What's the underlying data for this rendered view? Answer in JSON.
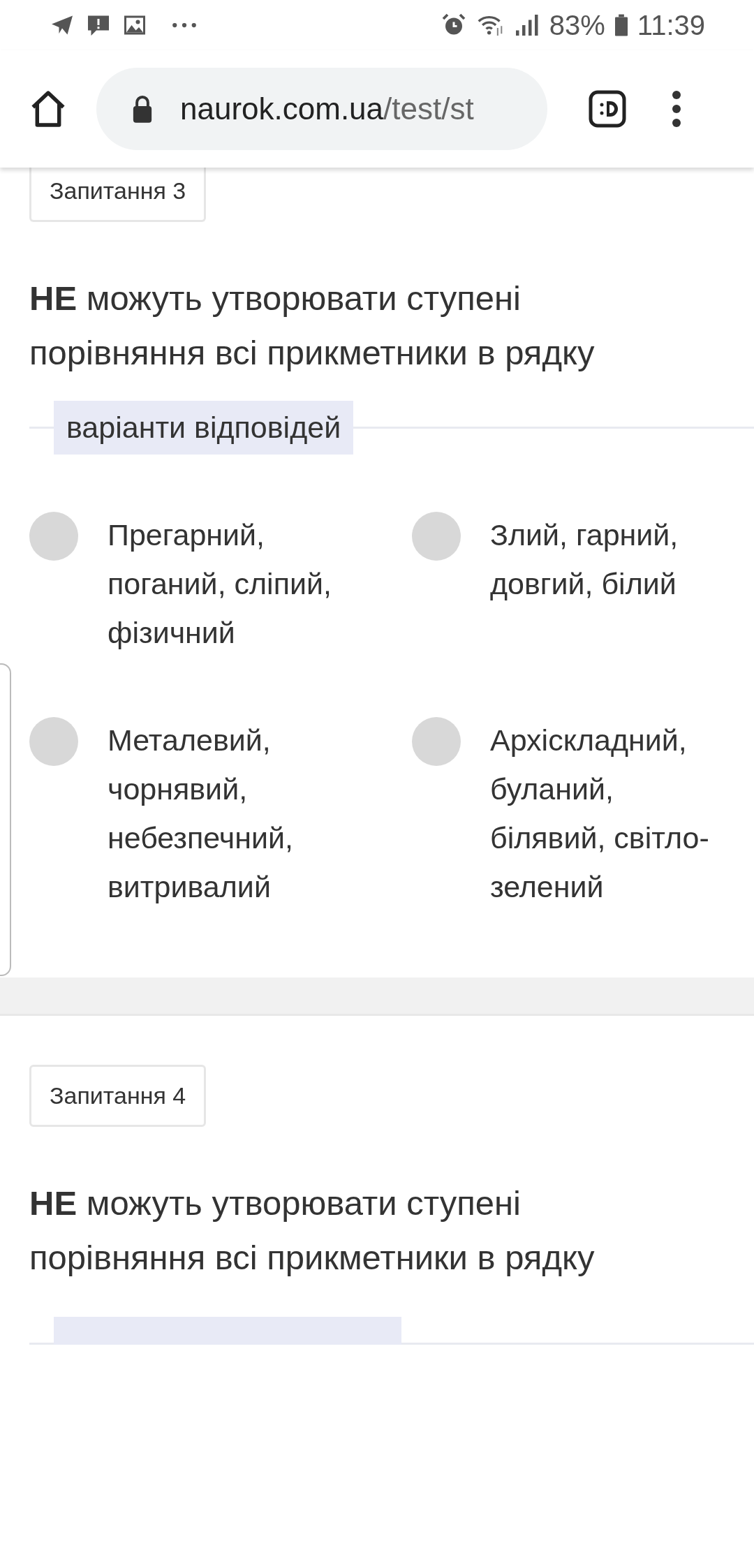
{
  "status_bar": {
    "battery": "83%",
    "time": "11:39"
  },
  "address_bar": {
    "host": "naurok.com.ua",
    "path": "/test/st"
  },
  "questions": [
    {
      "tag": "Запитання 3",
      "text": "**НЕ** можуть утворювати ступені порівняння всі прикметники в рядку",
      "options_label": "варіанти відповідей",
      "options": [
        {
          "text": "Прегарний, поганий, сліпий, фізичний",
          "selected": false
        },
        {
          "text": "Злий, гарний, довгий, білий",
          "selected": false
        },
        {
          "text": "Металевий, чорнявий, небезпечний, витривалий",
          "selected": false
        },
        {
          "text": "Архіскладний, буланий, білявий, світло-зелений",
          "selected": false
        }
      ]
    },
    {
      "tag": "Запитання 4",
      "text": "**НЕ** можуть утворювати ступені порівняння всі прикметники в рядку"
    }
  ]
}
